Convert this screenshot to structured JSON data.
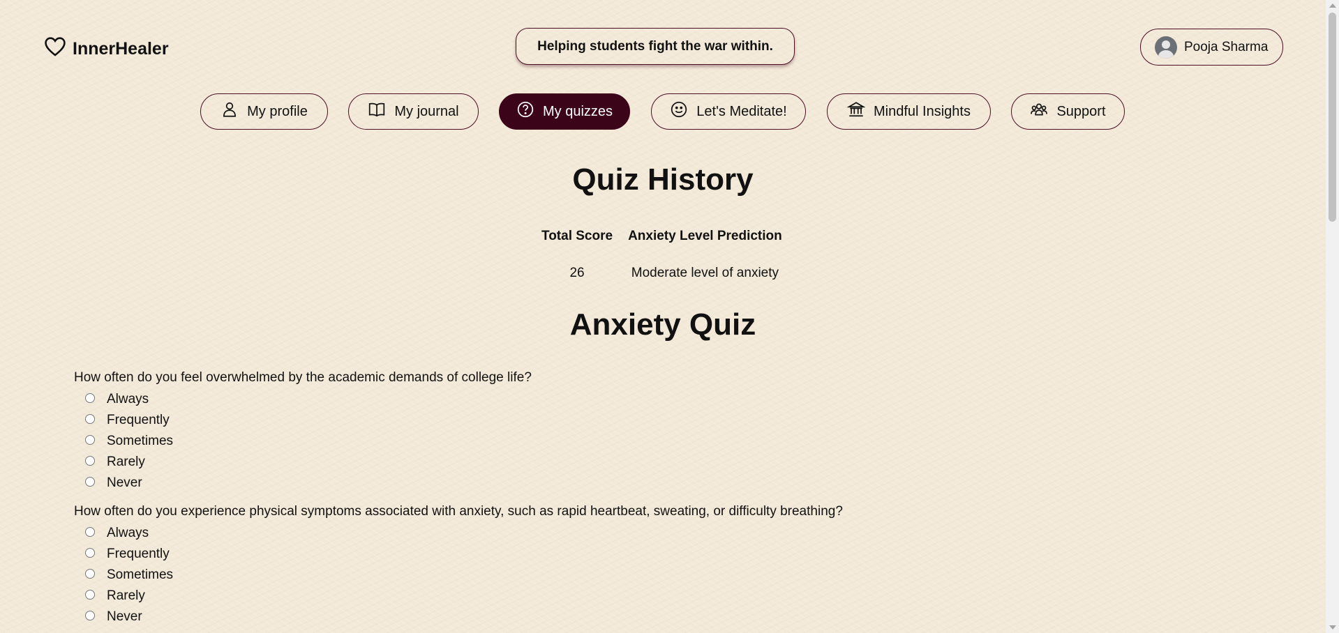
{
  "brand": {
    "name": "InnerHealer",
    "icon": "heart-icon"
  },
  "tagline": "Helping students fight the war within.",
  "user": {
    "name": "Pooja Sharma",
    "icon": "user-avatar-icon"
  },
  "nav": [
    {
      "label": "My profile",
      "icon": "person-icon",
      "active": false
    },
    {
      "label": "My journal",
      "icon": "book-icon",
      "active": false
    },
    {
      "label": "My quizzes",
      "icon": "question-circle-icon",
      "active": true
    },
    {
      "label": "Let's Meditate!",
      "icon": "smile-icon",
      "active": false
    },
    {
      "label": "Mindful Insights",
      "icon": "bank-icon",
      "active": false
    },
    {
      "label": "Support",
      "icon": "people-icon",
      "active": false
    }
  ],
  "history": {
    "title": "Quiz History",
    "columns": [
      "Total Score",
      "Anxiety Level Prediction"
    ],
    "rows": [
      [
        "26",
        "Moderate level of anxiety"
      ]
    ]
  },
  "quiz": {
    "title": "Anxiety Quiz",
    "questions": [
      {
        "text": "How often do you feel overwhelmed by the academic demands of college life?",
        "options": [
          "Always",
          "Frequently",
          "Sometimes",
          "Rarely",
          "Never"
        ]
      },
      {
        "text": "How often do you experience physical symptoms associated with anxiety, such as rapid heartbeat, sweating, or difficulty breathing?",
        "options": [
          "Always",
          "Frequently",
          "Sometimes",
          "Rarely",
          "Never"
        ]
      }
    ]
  },
  "colors": {
    "background": "#f3e9d8",
    "accent": "#3c0418",
    "border": "#4a0d22"
  }
}
